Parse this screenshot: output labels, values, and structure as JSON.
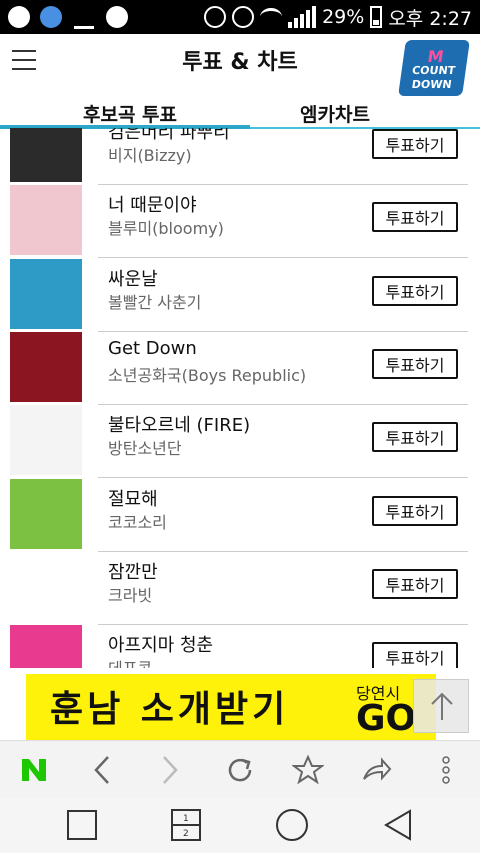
{
  "status_bar": {
    "battery": "29%",
    "time": "오후 2:27",
    "icons": [
      "u-plus-icon",
      "samsung-icon",
      "ringtone-icon",
      "leaf-icon",
      "mute-icon",
      "alarm-icon",
      "wifi-icon",
      "signal-icon",
      "battery-icon"
    ]
  },
  "app_bar": {
    "title": "투표 & 차트",
    "logo": {
      "line1": "M",
      "line2": "COUNT",
      "line3": "DOWN"
    }
  },
  "tabs": [
    {
      "label": "후보곡 투표",
      "active": true
    },
    {
      "label": "엠카차트",
      "active": false
    }
  ],
  "vote_label": "투표하기",
  "songs": [
    {
      "title": "검은머리 파뿌리",
      "artist": "비지(Bizzy)",
      "art_color": "#2b2b2b"
    },
    {
      "title": "너 때문이야",
      "artist": "블루미(bloomy)",
      "art_color": "#f1c7cf"
    },
    {
      "title": "싸운날",
      "artist": "볼빨간 사춘기",
      "art_color": "#2e9bc7"
    },
    {
      "title": "Get Down",
      "artist": "소년공화국(Boys Republic)",
      "art_color": "#8c1522"
    },
    {
      "title": "불타오르네 (FIRE)",
      "artist": "방탄소년단",
      "art_color": "#f4f4f4"
    },
    {
      "title": "절묘해",
      "artist": "코코소리",
      "art_color": "#7cc142"
    },
    {
      "title": "잠깐만",
      "artist": "크라빗",
      "art_color": "#ffffff"
    },
    {
      "title": "아프지마 청춘",
      "artist": "데프콘",
      "art_color": "#e83a8f"
    }
  ],
  "ad": {
    "main": "훈남 소개받기",
    "sub": "당연시",
    "cta": "GO"
  },
  "colors": {
    "accent": "#2aa7c9",
    "ad_bg": "#fff20a",
    "naver_green": "#1ec800"
  }
}
